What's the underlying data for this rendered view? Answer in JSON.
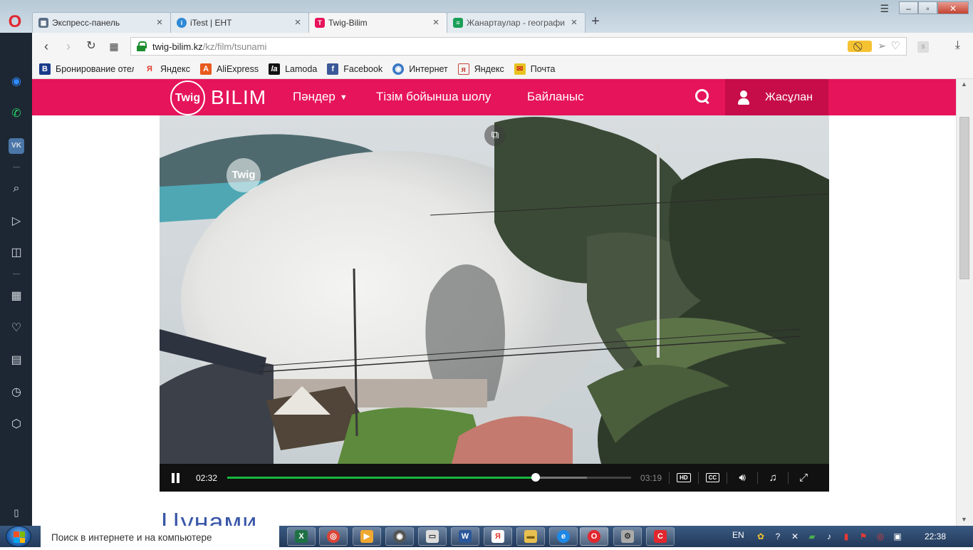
{
  "browser": {
    "tabs": [
      {
        "title": "Экспресс-панель",
        "icon": "grid-icon",
        "active": false
      },
      {
        "title": "iTest | ЕНТ",
        "icon": "itest-icon",
        "active": false
      },
      {
        "title": "Twig-Bilim",
        "icon": "twig-icon",
        "active": true
      },
      {
        "title": "Жанартаулар - географи",
        "icon": "sheets-icon",
        "active": false
      }
    ],
    "url_host": "twig-bilim.kz",
    "url_path": "/kz/film/tsunami",
    "adblock_glyph": "⃠",
    "extension_letter": "s",
    "bookmarks": [
      {
        "label": "Бронирование отел",
        "icon": "booking-icon",
        "badge": "B",
        "color": "#1a3b8a"
      },
      {
        "label": "Яндекс",
        "icon": "yandex-icon",
        "badge": "Я",
        "color": "#e23a2b"
      },
      {
        "label": "AliExpress",
        "icon": "aliexpress-icon",
        "badge": "A",
        "color": "#e85a1d"
      },
      {
        "label": "Lamoda",
        "icon": "lamoda-icon",
        "badge": "la",
        "color": "#111111"
      },
      {
        "label": "Facebook",
        "icon": "facebook-icon",
        "badge": "f",
        "color": "#3b5998"
      },
      {
        "label": "Интернет",
        "icon": "globe-icon",
        "badge": "◉",
        "color": "#3a77c4"
      },
      {
        "label": "Яндекс",
        "icon": "yandex-icon",
        "badge": "я",
        "color": "#c7463a"
      },
      {
        "label": "Почта",
        "icon": "mail-icon",
        "badge": "✉",
        "color": "#e7c320"
      }
    ]
  },
  "site": {
    "logo_mark": "Twig",
    "logo_word": "BILIM",
    "nav": {
      "subjects": "Пәндер",
      "browse": "Тізім бойынша шолу",
      "contact": "Байланыс"
    },
    "user_name": "Жасұлан",
    "brand_color": "#e6145a"
  },
  "video": {
    "watermark": "Twig",
    "time_current": "02:32",
    "time_total": "03:19",
    "played_fraction": 0.763,
    "buffered_fraction": 0.89,
    "hd_label": "HD",
    "cc_label": "CC"
  },
  "page_heading": "Цунами",
  "taskbar": {
    "search_placeholder": "Поиск в интернете и на компьютере",
    "language": "EN",
    "clock": "22:38"
  }
}
